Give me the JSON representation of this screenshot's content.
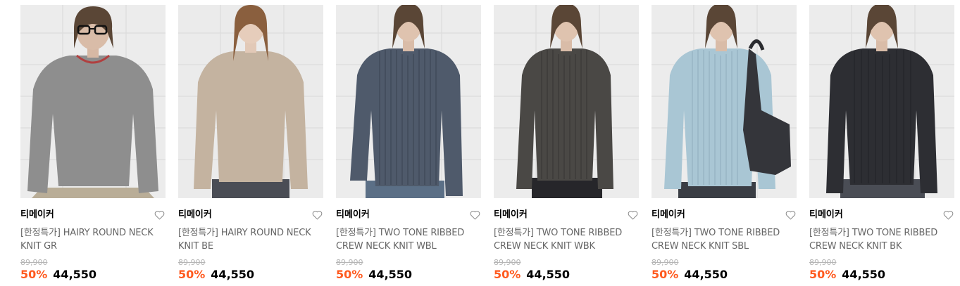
{
  "products": [
    {
      "brand": "티메이커",
      "title": "[한정특가] HAIRY ROUND NECK KNIT GR",
      "original_price": "89,900",
      "discount": "50%",
      "price": "44,550",
      "image_alt": "hairy round neck knit grey",
      "sweater_color": "#8e8e8e",
      "wishlist_icon": "heart-outline-icon"
    },
    {
      "brand": "티메이커",
      "title": "[한정특가] HAIRY ROUND NECK KNIT BE",
      "original_price": "89,900",
      "discount": "50%",
      "price": "44,550",
      "image_alt": "hairy round neck knit beige",
      "sweater_color": "#c4b3a0",
      "wishlist_icon": "heart-outline-icon"
    },
    {
      "brand": "티메이커",
      "title": "[한정특가] TWO TONE RIBBED CREW NECK KNIT WBL",
      "original_price": "89,900",
      "discount": "50%",
      "price": "44,550",
      "image_alt": "two tone ribbed crew neck knit washed blue",
      "sweater_color": "#4f5a6b",
      "wishlist_icon": "heart-outline-icon"
    },
    {
      "brand": "티메이커",
      "title": "[한정특가] TWO TONE RIBBED CREW NECK KNIT WBK",
      "original_price": "89,900",
      "discount": "50%",
      "price": "44,550",
      "image_alt": "two tone ribbed crew neck knit washed black",
      "sweater_color": "#4a4845",
      "wishlist_icon": "heart-outline-icon"
    },
    {
      "brand": "티메이커",
      "title": "[한정특가] TWO TONE RIBBED CREW NECK KNIT SBL",
      "original_price": "89,900",
      "discount": "50%",
      "price": "44,550",
      "image_alt": "two tone ribbed crew neck knit sky blue",
      "sweater_color": "#a9c6d4",
      "wishlist_icon": "heart-outline-icon"
    },
    {
      "brand": "티메이커",
      "title": "[한정특가] TWO TONE RIBBED CREW NECK KNIT BK",
      "original_price": "89,900",
      "discount": "50%",
      "price": "44,550",
      "image_alt": "two tone ribbed crew neck knit black",
      "sweater_color": "#2d2e33",
      "wishlist_icon": "heart-outline-icon"
    }
  ],
  "colors": {
    "discount": "#ff5a1f",
    "title": "#666666",
    "original_price": "#b5b5b5",
    "wall": "#e8e8e8"
  }
}
